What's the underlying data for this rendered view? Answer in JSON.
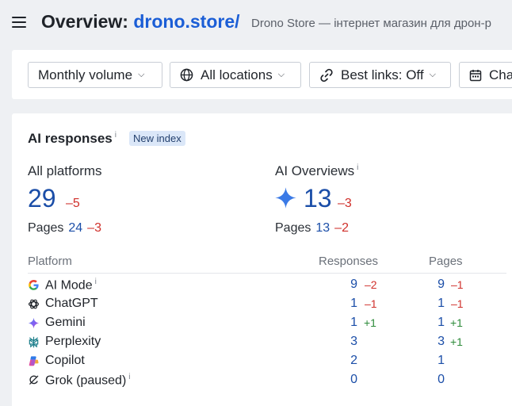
{
  "header": {
    "title_prefix": "Overview:",
    "domain": "drono.store/",
    "subtitle": "Drono Store — інтернет магазин для дрон-р"
  },
  "filters": {
    "volume": "Monthly volume",
    "locations": "All locations",
    "best_links": "Best links: Off",
    "chart": "Cha"
  },
  "ai_responses": {
    "title": "AI responses",
    "info": "i",
    "badge": "New index",
    "all_platforms": {
      "label": "All platforms",
      "value": "29",
      "delta": "–5",
      "pages_label": "Pages",
      "pages_value": "24",
      "pages_delta": "–3"
    },
    "ai_overviews": {
      "label": "AI Overviews",
      "info": "i",
      "value": "13",
      "delta": "–3",
      "pages_label": "Pages",
      "pages_value": "13",
      "pages_delta": "–2"
    },
    "table": {
      "headers": {
        "platform": "Platform",
        "responses": "Responses",
        "pages": "Pages"
      },
      "rows": [
        {
          "name": "AI Mode",
          "info": "i",
          "icon": "google-icon",
          "responses": "9",
          "responses_delta": "–2",
          "pages": "9",
          "pages_delta": "–1"
        },
        {
          "name": "ChatGPT",
          "info": "",
          "icon": "chatgpt-icon",
          "responses": "1",
          "responses_delta": "–1",
          "pages": "1",
          "pages_delta": "–1"
        },
        {
          "name": "Gemini",
          "info": "",
          "icon": "gemini-icon",
          "responses": "1",
          "responses_delta": "+1",
          "pages": "1",
          "pages_delta": "+1"
        },
        {
          "name": "Perplexity",
          "info": "",
          "icon": "perplexity-icon",
          "responses": "3",
          "responses_delta": "",
          "pages": "3",
          "pages_delta": "+1"
        },
        {
          "name": "Copilot",
          "info": "",
          "icon": "copilot-icon",
          "responses": "2",
          "responses_delta": "",
          "pages": "1",
          "pages_delta": ""
        },
        {
          "name": "Grok (paused)",
          "info": "i",
          "icon": "grok-icon",
          "responses": "0",
          "responses_delta": "",
          "pages": "0",
          "pages_delta": ""
        }
      ]
    }
  },
  "colors": {
    "accent": "#1b5ed6",
    "value_blue": "#1b4ea8",
    "negative": "#d0302b",
    "positive": "#2e8b3a",
    "badge_bg": "#dbe7f8"
  }
}
